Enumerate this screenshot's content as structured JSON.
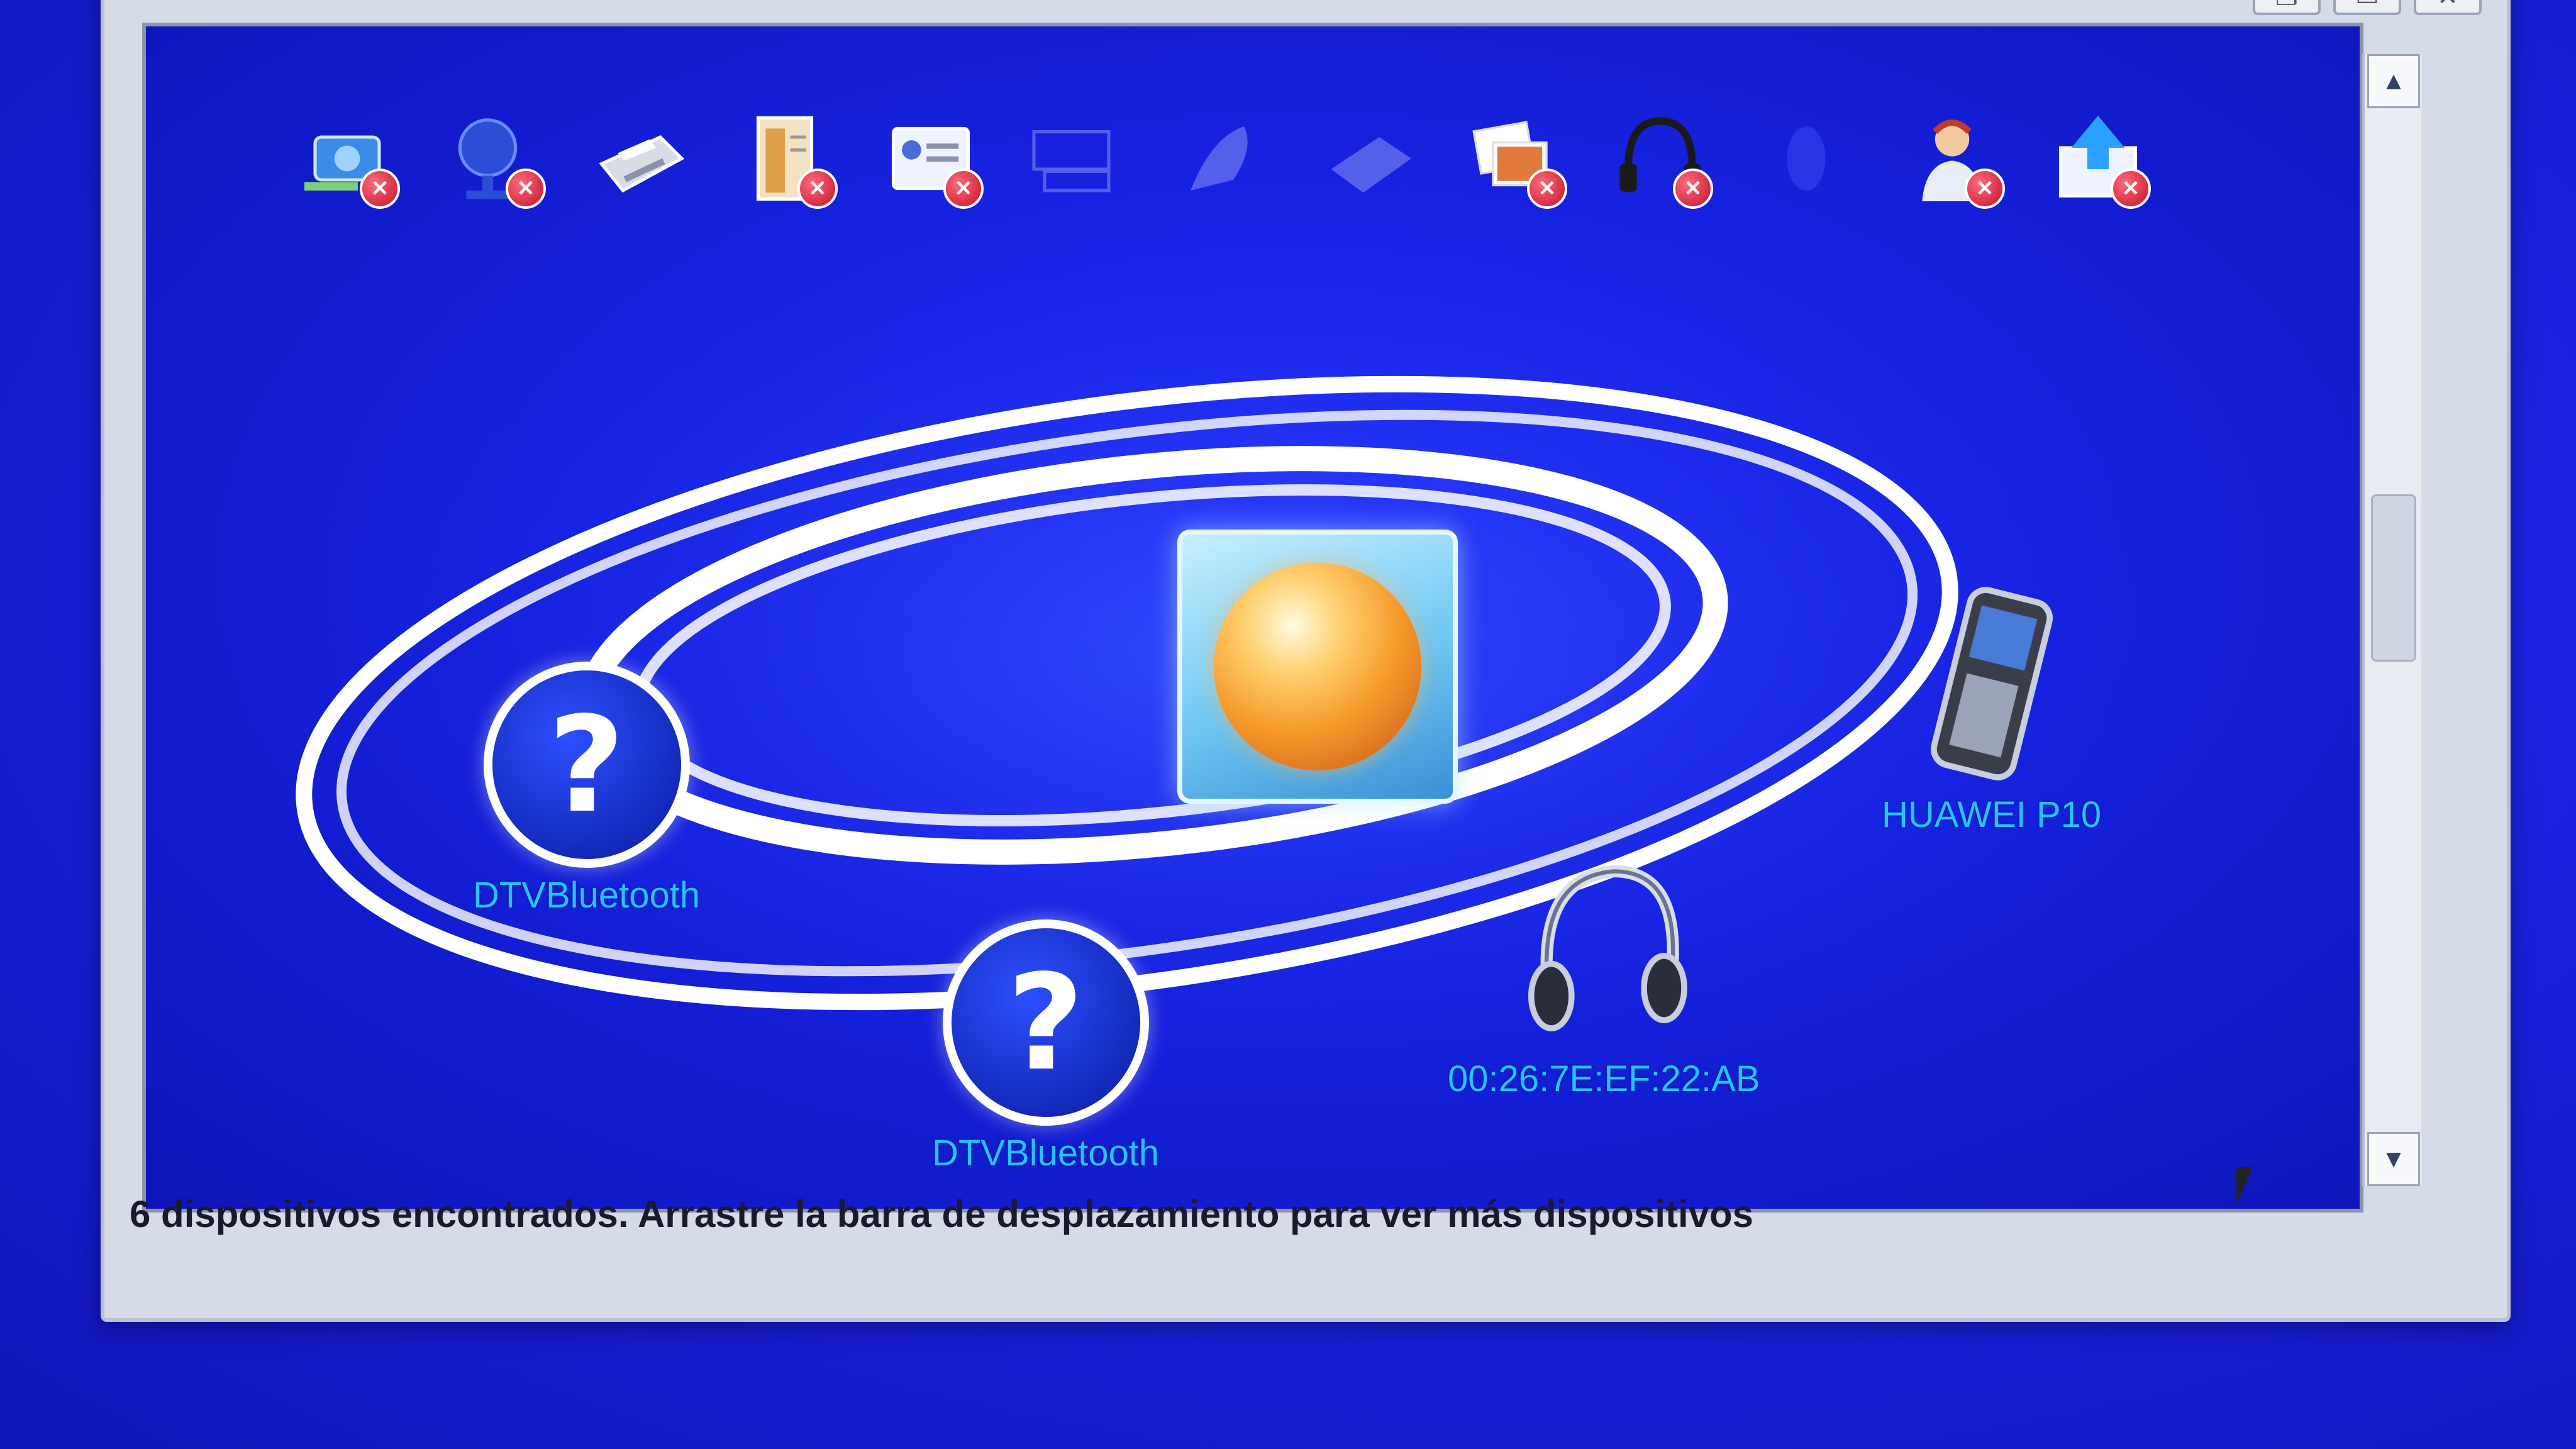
{
  "window": {
    "controls": [
      "restore",
      "maximize",
      "close"
    ]
  },
  "toolbar": {
    "items": [
      {
        "name": "camera-device-icon",
        "disabled": true
      },
      {
        "name": "network-globe-icon",
        "disabled": true
      },
      {
        "name": "printer-icon",
        "disabled": false
      },
      {
        "name": "file-transfer-icon",
        "disabled": true
      },
      {
        "name": "business-card-icon",
        "disabled": true
      },
      {
        "name": "keyboard-icon",
        "disabled": false
      },
      {
        "name": "mouse-icon",
        "disabled": false
      },
      {
        "name": "fax-icon",
        "disabled": false
      },
      {
        "name": "image-transfer-icon",
        "disabled": true
      },
      {
        "name": "headset-icon",
        "disabled": true
      },
      {
        "name": "bluetooth-icon",
        "disabled": false
      },
      {
        "name": "personal-network-icon",
        "disabled": true
      },
      {
        "name": "sync-upload-icon",
        "disabled": true
      }
    ]
  },
  "devices": [
    {
      "id": "d1",
      "label": "DTVBluetooth",
      "type": "unknown"
    },
    {
      "id": "d2",
      "label": "DTVBluetooth",
      "type": "unknown"
    },
    {
      "id": "d3",
      "label": "00:26:7E:EF:22:AB",
      "type": "headphones"
    },
    {
      "id": "d4",
      "label": "HUAWEI P10",
      "type": "phone"
    }
  ],
  "status": {
    "text": "6 dispositivos encontrados. Arrastre la barra de desplazamiento para ver más dispositivos"
  },
  "colors": {
    "background": "#1a1fd8",
    "label": "#26c4ff",
    "orbit": "#ffffff"
  }
}
